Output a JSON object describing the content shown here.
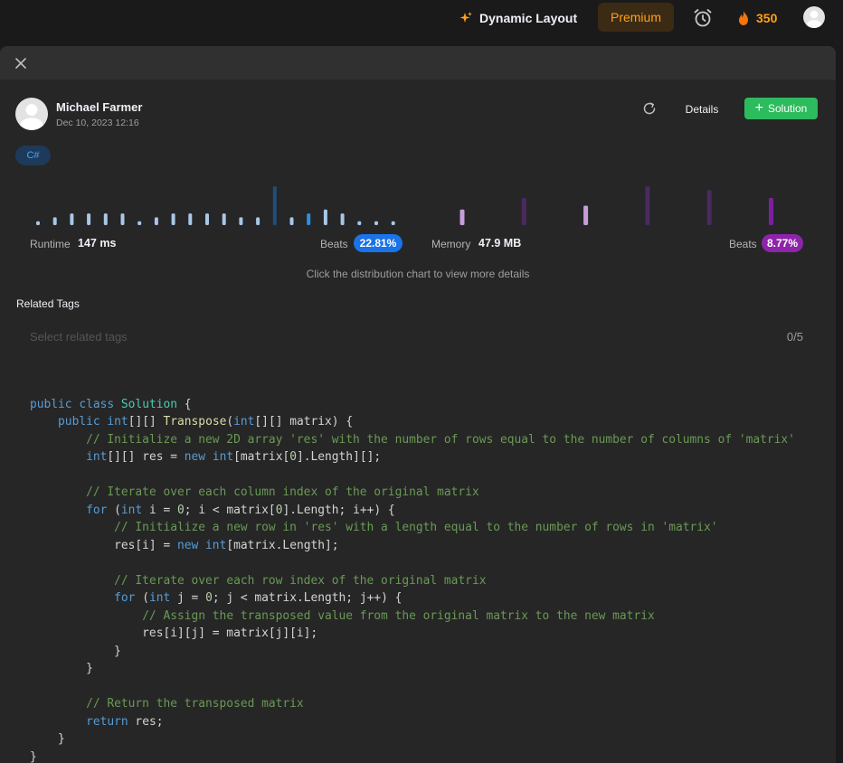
{
  "topbar": {
    "dynamic_layout_label": "Dynamic Layout",
    "premium_label": "Premium",
    "streak_count": "350",
    "accent_color": "#ffa116"
  },
  "submission": {
    "author_name": "Michael Farmer",
    "date": "Dec 10, 2023 12:16",
    "details_label": "Details",
    "solution_label": "Solution",
    "language": "C#"
  },
  "runtime": {
    "label": "Runtime",
    "value": "147 ms",
    "beats_label": "Beats",
    "beats": "22.81%",
    "beats_color": "#1a73e8"
  },
  "memory": {
    "label": "Memory",
    "value": "47.9 MB",
    "beats_label": "Beats",
    "beats": "8.77%",
    "beats_color": "#8e24aa"
  },
  "chart_hint": "Click the distribution chart to view more details",
  "related_tags": {
    "title": "Related Tags",
    "placeholder": "Select related tags",
    "count": "0/5"
  },
  "chart_data": [
    {
      "type": "bar",
      "series": "runtime distribution",
      "values": [
        1,
        2,
        3,
        3,
        3,
        3,
        1,
        2,
        3,
        3,
        3,
        3,
        2,
        2,
        10,
        2,
        3,
        4,
        3,
        1,
        1,
        1
      ],
      "highlight_index": 16
    },
    {
      "type": "bar",
      "series": "memory distribution",
      "values": [
        4,
        7,
        5,
        10,
        9,
        7
      ],
      "highlight_index": 5
    }
  ],
  "code_lines": [
    "",
    "",
    "",
    "public class Solution {",
    "    public int[][] Transpose(int[][] matrix) {",
    "        // Initialize a new 2D array 'res' with the number of rows equal to the number of columns of 'matrix'",
    "        int[][] res = new int[matrix[0].Length][];",
    "",
    "        // Iterate over each column index of the original matrix",
    "        for (int i = 0; i < matrix[0].Length; i++) {",
    "            // Initialize a new row in 'res' with a length equal to the number of rows in 'matrix'",
    "            res[i] = new int[matrix.Length];",
    "",
    "            // Iterate over each row index of the original matrix",
    "            for (int j = 0; j < matrix.Length; j++) {",
    "                // Assign the transposed value from the original matrix to the new matrix",
    "                res[i][j] = matrix[j][i];",
    "            }",
    "        }",
    "",
    "        // Return the transposed matrix",
    "        return res;",
    "    }",
    "}"
  ]
}
